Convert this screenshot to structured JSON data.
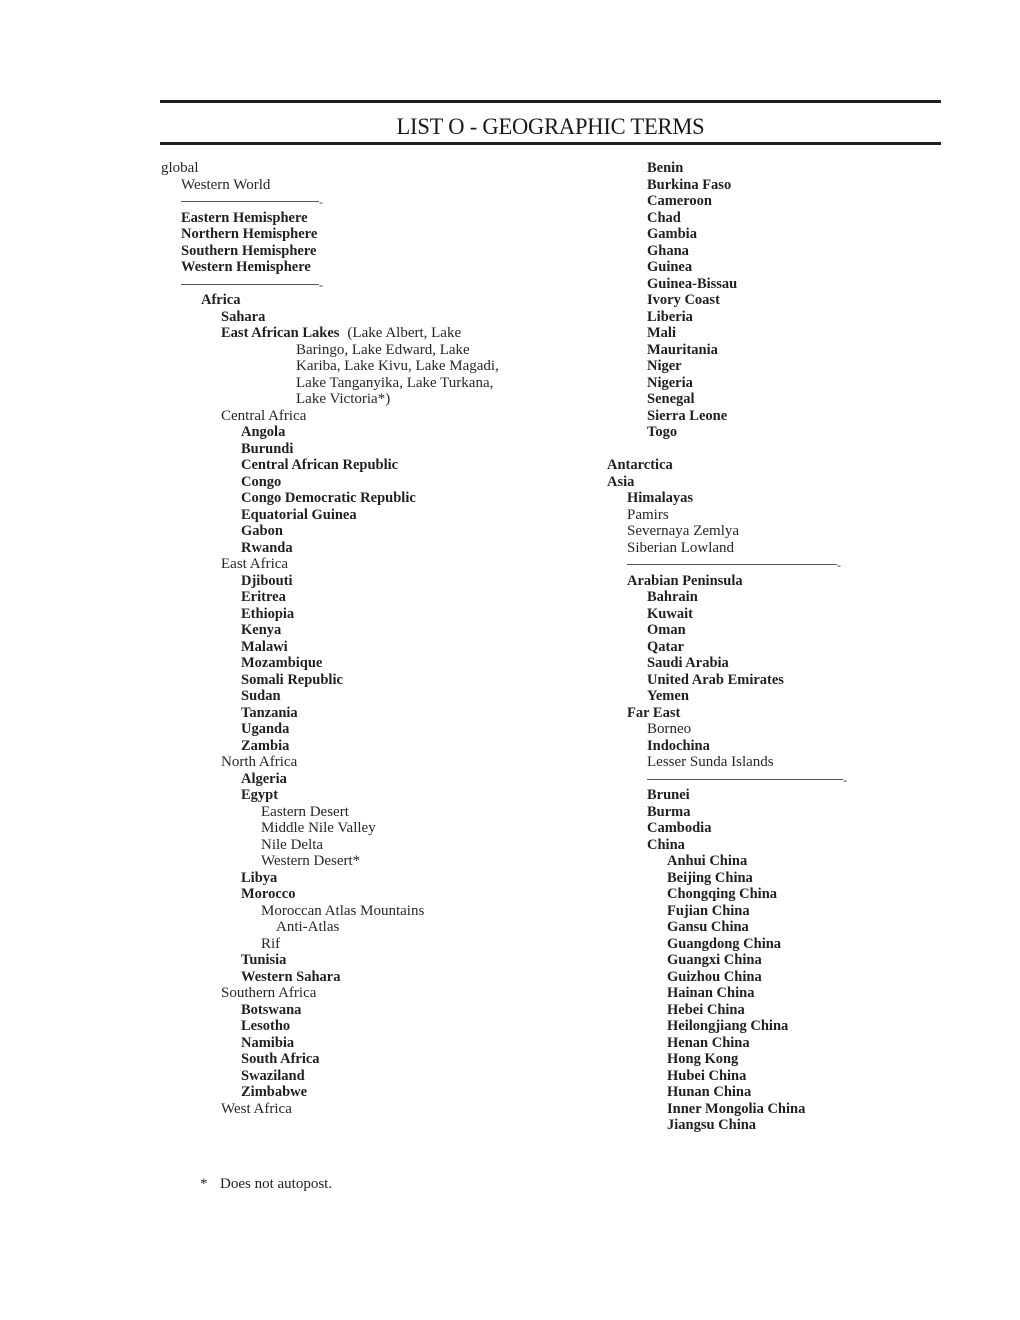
{
  "page": {
    "title": "LIST O - GEOGRAPHIC TERMS",
    "footnote": {
      "marker": "*",
      "text": "Does not autopost."
    }
  },
  "left_column": [
    {
      "text": "global",
      "level": 0,
      "bold": false
    },
    {
      "text": "Western World",
      "level": 1,
      "bold": false
    },
    {
      "type": "divider",
      "level": 1
    },
    {
      "text": "Eastern Hemisphere",
      "level": 1,
      "bold": true
    },
    {
      "text": "Northern Hemisphere",
      "level": 1,
      "bold": true
    },
    {
      "text": "Southern Hemisphere",
      "level": 1,
      "bold": true
    },
    {
      "text": "Western Hemisphere",
      "level": 1,
      "bold": true
    },
    {
      "type": "divider",
      "level": 1
    },
    {
      "text": "Africa",
      "level": 2,
      "bold": true
    },
    {
      "text": "Sahara",
      "level": 3,
      "bold": true
    },
    {
      "text": "East African Lakes",
      "level": 3,
      "bold": true,
      "note": "(Lake Albert, Lake"
    },
    {
      "text": "Baringo, Lake Edward, Lake",
      "level": "cont",
      "bold": false
    },
    {
      "text": "Kariba, Lake Kivu, Lake Magadi,",
      "level": "cont",
      "bold": false
    },
    {
      "text": "Lake Tanganyika, Lake Turkana,",
      "level": "cont",
      "bold": false
    },
    {
      "text": "Lake Victoria*)",
      "level": "cont",
      "bold": false
    },
    {
      "text": "Central Africa",
      "level": 3,
      "bold": false
    },
    {
      "text": "Angola",
      "level": 4,
      "bold": true
    },
    {
      "text": "Burundi",
      "level": 4,
      "bold": true
    },
    {
      "text": "Central African Republic",
      "level": 4,
      "bold": true
    },
    {
      "text": "Congo",
      "level": 4,
      "bold": true
    },
    {
      "text": "Congo Democratic Republic",
      "level": 4,
      "bold": true
    },
    {
      "text": "Equatorial Guinea",
      "level": 4,
      "bold": true
    },
    {
      "text": "Gabon",
      "level": 4,
      "bold": true
    },
    {
      "text": "Rwanda",
      "level": 4,
      "bold": true
    },
    {
      "text": "East Africa",
      "level": 3,
      "bold": false
    },
    {
      "text": "Djibouti",
      "level": 4,
      "bold": true
    },
    {
      "text": "Eritrea",
      "level": 4,
      "bold": true
    },
    {
      "text": "Ethiopia",
      "level": 4,
      "bold": true
    },
    {
      "text": "Kenya",
      "level": 4,
      "bold": true
    },
    {
      "text": "Malawi",
      "level": 4,
      "bold": true
    },
    {
      "text": "Mozambique",
      "level": 4,
      "bold": true
    },
    {
      "text": "Somali Republic",
      "level": 4,
      "bold": true
    },
    {
      "text": "Sudan",
      "level": 4,
      "bold": true
    },
    {
      "text": "Tanzania",
      "level": 4,
      "bold": true
    },
    {
      "text": "Uganda",
      "level": 4,
      "bold": true
    },
    {
      "text": "Zambia",
      "level": 4,
      "bold": true
    },
    {
      "text": "North Africa",
      "level": 3,
      "bold": false
    },
    {
      "text": "Algeria",
      "level": 4,
      "bold": true
    },
    {
      "text": "Egypt",
      "level": 4,
      "bold": true
    },
    {
      "text": "Eastern Desert",
      "level": 5,
      "bold": false
    },
    {
      "text": "Middle Nile Valley",
      "level": 5,
      "bold": false
    },
    {
      "text": "Nile Delta",
      "level": 5,
      "bold": false
    },
    {
      "text": "Western Desert*",
      "level": 5,
      "bold": false
    },
    {
      "text": "Libya",
      "level": 4,
      "bold": true
    },
    {
      "text": "Morocco",
      "level": 4,
      "bold": true
    },
    {
      "text": "Moroccan Atlas Mountains",
      "level": 5,
      "bold": false
    },
    {
      "text": "Anti-Atlas",
      "level": 6,
      "bold": false
    },
    {
      "text": "Rif",
      "level": 5,
      "bold": false
    },
    {
      "text": "Tunisia",
      "level": 4,
      "bold": true
    },
    {
      "text": "Western Sahara",
      "level": 4,
      "bold": true
    },
    {
      "text": "Southern Africa",
      "level": 3,
      "bold": false
    },
    {
      "text": "Botswana",
      "level": 4,
      "bold": true
    },
    {
      "text": "Lesotho",
      "level": 4,
      "bold": true
    },
    {
      "text": "Namibia",
      "level": 4,
      "bold": true
    },
    {
      "text": "South Africa",
      "level": 4,
      "bold": true
    },
    {
      "text": "Swaziland",
      "level": 4,
      "bold": true
    },
    {
      "text": "Zimbabwe",
      "level": 4,
      "bold": true
    },
    {
      "text": "West Africa",
      "level": 3,
      "bold": false
    }
  ],
  "right_column": [
    {
      "text": "Benin",
      "level": 2,
      "bold": true
    },
    {
      "text": "Burkina Faso",
      "level": 2,
      "bold": true
    },
    {
      "text": "Cameroon",
      "level": 2,
      "bold": true
    },
    {
      "text": "Chad",
      "level": 2,
      "bold": true
    },
    {
      "text": "Gambia",
      "level": 2,
      "bold": true
    },
    {
      "text": "Ghana",
      "level": 2,
      "bold": true
    },
    {
      "text": "Guinea",
      "level": 2,
      "bold": true
    },
    {
      "text": "Guinea-Bissau",
      "level": 2,
      "bold": true
    },
    {
      "text": "Ivory Coast",
      "level": 2,
      "bold": true
    },
    {
      "text": "Liberia",
      "level": 2,
      "bold": true
    },
    {
      "text": "Mali",
      "level": 2,
      "bold": true
    },
    {
      "text": "Mauritania",
      "level": 2,
      "bold": true
    },
    {
      "text": "Niger",
      "level": 2,
      "bold": true
    },
    {
      "text": "Nigeria",
      "level": 2,
      "bold": true
    },
    {
      "text": "Senegal",
      "level": 2,
      "bold": true
    },
    {
      "text": "Sierra Leone",
      "level": 2,
      "bold": true
    },
    {
      "text": "Togo",
      "level": 2,
      "bold": true
    },
    {
      "type": "blank"
    },
    {
      "text": "Antarctica",
      "level": 0,
      "bold": true
    },
    {
      "text": "Asia",
      "level": 0,
      "bold": true
    },
    {
      "text": "Himalayas",
      "level": 1,
      "bold": true
    },
    {
      "text": "Pamirs",
      "level": 1,
      "bold": false
    },
    {
      "text": "Severnaya Zemlya",
      "level": 1,
      "bold": false
    },
    {
      "text": "Siberian Lowland",
      "level": 1,
      "bold": false
    },
    {
      "type": "divider",
      "level": 1
    },
    {
      "text": "Arabian Peninsula",
      "level": 1,
      "bold": true
    },
    {
      "text": "Bahrain",
      "level": 2,
      "bold": true
    },
    {
      "text": "Kuwait",
      "level": 2,
      "bold": true
    },
    {
      "text": "Oman",
      "level": 2,
      "bold": true
    },
    {
      "text": "Qatar",
      "level": 2,
      "bold": true
    },
    {
      "text": "Saudi Arabia",
      "level": 2,
      "bold": true
    },
    {
      "text": "United Arab Emirates",
      "level": 2,
      "bold": true
    },
    {
      "text": "Yemen",
      "level": 2,
      "bold": true
    },
    {
      "text": "Far East",
      "level": 1,
      "bold": true
    },
    {
      "text": "Borneo",
      "level": 2,
      "bold": false
    },
    {
      "text": "Indochina",
      "level": 2,
      "bold": true
    },
    {
      "text": "Lesser Sunda Islands",
      "level": 2,
      "bold": false
    },
    {
      "type": "divider",
      "level": 2
    },
    {
      "text": "Brunei",
      "level": 2,
      "bold": true
    },
    {
      "text": "Burma",
      "level": 2,
      "bold": true
    },
    {
      "text": "Cambodia",
      "level": 2,
      "bold": true
    },
    {
      "text": "China",
      "level": 2,
      "bold": true
    },
    {
      "text": "Anhui China",
      "level": 3,
      "bold": true
    },
    {
      "text": "Beijing China",
      "level": 3,
      "bold": true
    },
    {
      "text": "Chongqing China",
      "level": 3,
      "bold": true
    },
    {
      "text": "Fujian China",
      "level": 3,
      "bold": true
    },
    {
      "text": "Gansu China",
      "level": 3,
      "bold": true
    },
    {
      "text": "Guangdong China",
      "level": 3,
      "bold": true
    },
    {
      "text": "Guangxi China",
      "level": 3,
      "bold": true
    },
    {
      "text": "Guizhou China",
      "level": 3,
      "bold": true
    },
    {
      "text": "Hainan China",
      "level": 3,
      "bold": true
    },
    {
      "text": "Hebei China",
      "level": 3,
      "bold": true
    },
    {
      "text": "Heilongjiang China",
      "level": 3,
      "bold": true
    },
    {
      "text": "Henan China",
      "level": 3,
      "bold": true
    },
    {
      "text": "Hong Kong",
      "level": 3,
      "bold": true
    },
    {
      "text": "Hubei China",
      "level": 3,
      "bold": true
    },
    {
      "text": "Hunan China",
      "level": 3,
      "bold": true
    },
    {
      "text": "Inner Mongolia China",
      "level": 3,
      "bold": true
    },
    {
      "text": "Jiangsu China",
      "level": 3,
      "bold": true
    }
  ]
}
